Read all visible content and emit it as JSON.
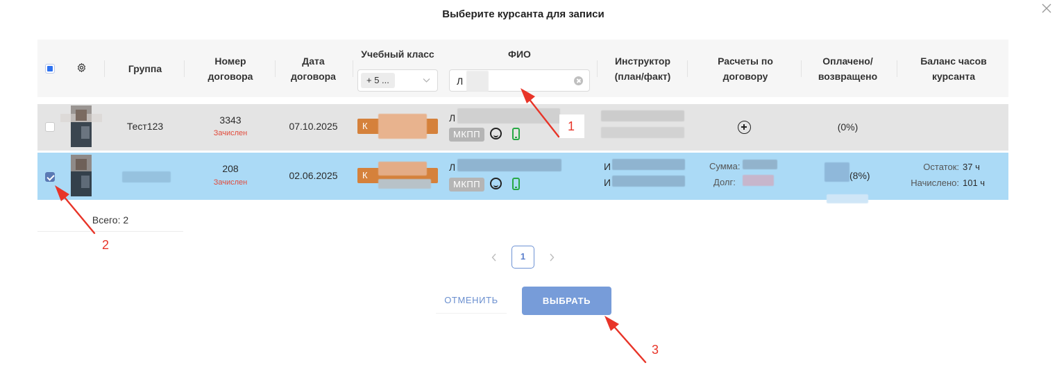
{
  "modal": {
    "title": "Выберите курсанта для записи"
  },
  "columns": {
    "group": "Группа",
    "contract_number": "Номер договора",
    "contract_date": "Дата договора",
    "classroom": "Учебный класс",
    "fio": "ФИО",
    "instructor": "Инструктор (план/факт)",
    "payments": "Расчеты по договору",
    "paid": "Оплачено/ возвращено",
    "balance": "Баланс часов курсанта"
  },
  "filters": {
    "classroom_tag": "+ 5 ...",
    "fio_value": "Л"
  },
  "rows": [
    {
      "group": "Тест123",
      "contract_number": "3343",
      "status": "Зачислен",
      "contract_date": "07.10.2025",
      "classroom_prefix": "К",
      "fio_initial": "Л",
      "transmission": "МКПП",
      "paid": "(0%)",
      "checked": false
    },
    {
      "group": "",
      "contract_number": "208",
      "status": "Зачислен",
      "contract_date": "02.06.2025",
      "classroom_prefix": "К",
      "fio_initial": "Л",
      "transmission": "МКПП",
      "instructor_line1": "И",
      "instructor_line2": "И",
      "sum_label": "Сумма:",
      "debt_label": "Долг:",
      "paid": "(8%)",
      "remaining_label": "Остаток:",
      "remaining_value": "37 ч",
      "accrued_label": "Начислено:",
      "accrued_value": "101 ч",
      "checked": true
    }
  ],
  "footer": {
    "total": "Всего: 2"
  },
  "pagination": {
    "current_page": "1"
  },
  "actions": {
    "cancel": "ОТМЕНИТЬ",
    "select": "ВЫБРАТЬ"
  },
  "annotations": [
    "1",
    "2",
    "3"
  ],
  "colors": {
    "selected_row": "#abdaf6",
    "hover_row": "#e4e4e4",
    "primary_button": "#779cd9",
    "classroom_bar": "#d5813b",
    "status_red": "#e14b3c",
    "annotation_red": "#e83428"
  }
}
